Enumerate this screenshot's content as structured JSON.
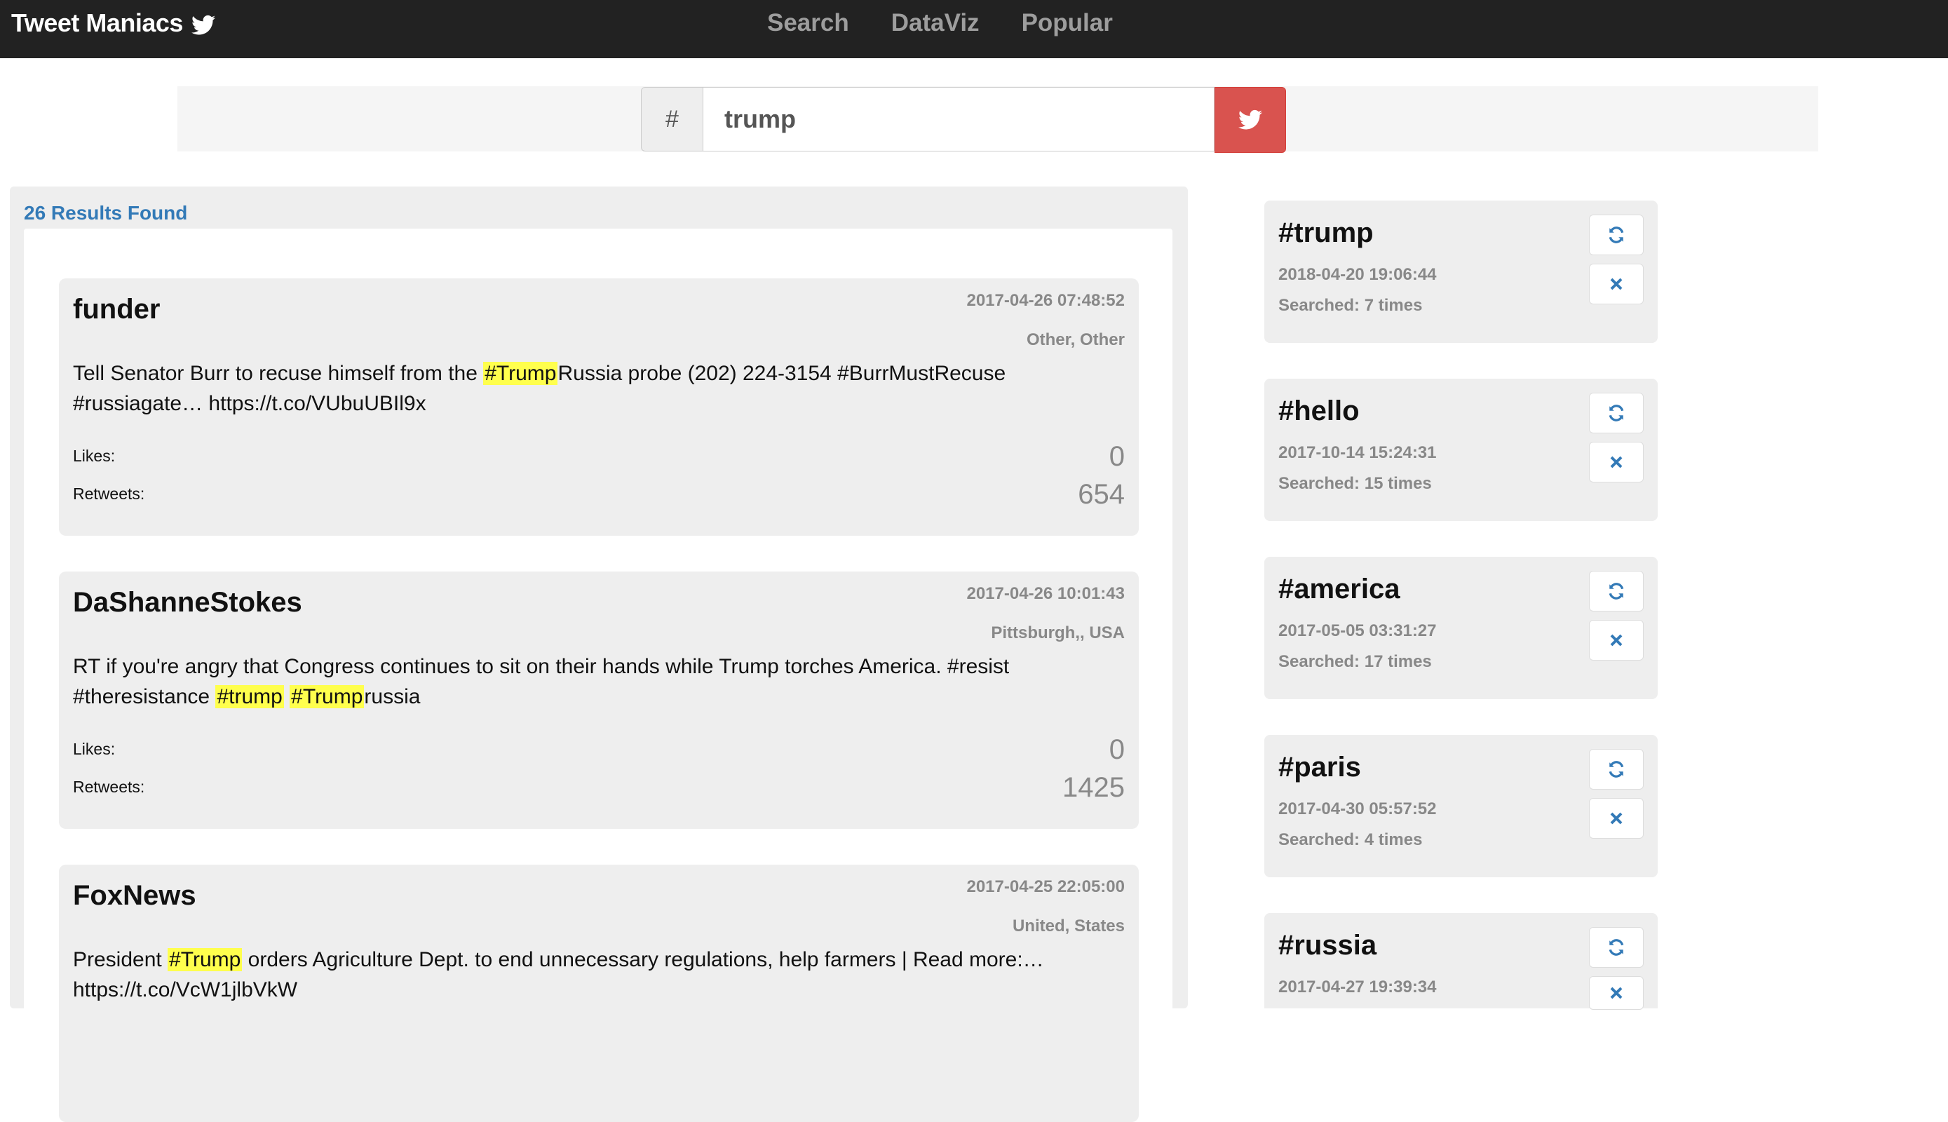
{
  "navbar": {
    "brand": "Tweet Maniacs",
    "brand_icon": "twitter-bird-icon",
    "links": [
      "Search",
      "DataViz",
      "Popular"
    ]
  },
  "search": {
    "prefix": "#",
    "value": "trump",
    "submit_icon": "twitter-bird-icon",
    "button_color": "#d9534f"
  },
  "results": {
    "count_label": "26 Results Found",
    "tweets": [
      {
        "user": "funder",
        "date": "2017-04-26 07:48:52",
        "location": "Other, Other",
        "text_parts": [
          "Tell Senator Burr to recuse himself from the ",
          "#Trump",
          "Russia probe (202) 224-3154 #BurrMustRecuse #russiagate… https://t.co/VUbuUBIl9x"
        ],
        "likes_label": "Likes:",
        "likes": "0",
        "retweets_label": "Retweets:",
        "retweets": "654"
      },
      {
        "user": "DaShanneStokes",
        "date": "2017-04-26 10:01:43",
        "location": "Pittsburgh,, USA",
        "text_parts": [
          "RT if you're angry that Congress continues to sit on their hands while Trump torches America. #resist #theresistance ",
          "#trump",
          " ",
          "#Trump",
          "russia"
        ],
        "likes_label": "Likes:",
        "likes": "0",
        "retweets_label": "Retweets:",
        "retweets": "1425"
      },
      {
        "user": "FoxNews",
        "date": "2017-04-25 22:05:00",
        "location": "United, States",
        "text_parts": [
          "President ",
          "#Trump",
          " orders Agriculture Dept. to end unnecessary regulations, help farmers | Read more:… https://t.co/VcW1jlbVkW"
        ]
      }
    ]
  },
  "history": [
    {
      "tag": "#trump",
      "timestamp": "2018-04-20 19:06:44",
      "count": "Searched: 7 times"
    },
    {
      "tag": "#hello",
      "timestamp": "2017-10-14 15:24:31",
      "count": "Searched: 15 times"
    },
    {
      "tag": "#america",
      "timestamp": "2017-05-05 03:31:27",
      "count": "Searched: 17 times"
    },
    {
      "tag": "#paris",
      "timestamp": "2017-04-30 05:57:52",
      "count": "Searched: 4 times"
    },
    {
      "tag": "#russia",
      "timestamp": "2017-04-27 19:39:34",
      "count": ""
    }
  ],
  "colors": {
    "navbar": "#222222",
    "link": "#9d9d9d",
    "accent_blue": "#337ab7",
    "highlight": "#ffff4d"
  }
}
